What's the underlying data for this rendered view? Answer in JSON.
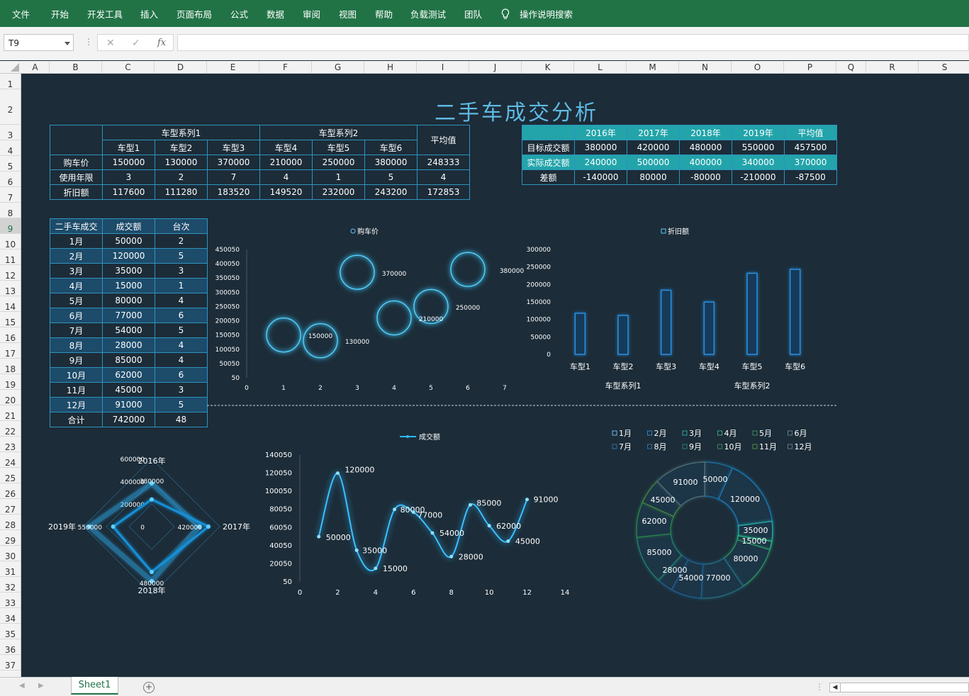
{
  "ribbon": {
    "tabs": [
      "文件",
      "开始",
      "开发工具",
      "插入",
      "页面布局",
      "公式",
      "数据",
      "审阅",
      "视图",
      "帮助",
      "负载测试",
      "团队"
    ],
    "search": "操作说明搜索"
  },
  "formula_bar": {
    "name_box": "T9",
    "cancel": "✕",
    "enter": "✓",
    "fx": "fx",
    "formula": ""
  },
  "columns": [
    "A",
    "B",
    "C",
    "D",
    "E",
    "F",
    "G",
    "H",
    "I",
    "J",
    "K",
    "L",
    "M",
    "N",
    "O",
    "P",
    "Q",
    "R",
    "S"
  ],
  "rows": [
    "1",
    "2",
    "3",
    "4",
    "5",
    "6",
    "7",
    "8",
    "9",
    "10",
    "11",
    "12",
    "13",
    "14",
    "15",
    "16",
    "17",
    "18",
    "19",
    "20",
    "21",
    "22",
    "23",
    "24",
    "25",
    "26",
    "27",
    "28",
    "29",
    "30",
    "31",
    "32",
    "33",
    "34",
    "35",
    "36",
    "37"
  ],
  "sheet_title": "二手车成交分析",
  "table1": {
    "group1": "车型系列1",
    "group2": "车型系列2",
    "avg": "平均值",
    "models": [
      "车型1",
      "车型2",
      "车型3",
      "车型4",
      "车型5",
      "车型6"
    ],
    "rows": [
      {
        "label": "购车价",
        "values": [
          "150000",
          "130000",
          "370000",
          "210000",
          "250000",
          "380000",
          "248333"
        ]
      },
      {
        "label": "使用年限",
        "values": [
          "3",
          "2",
          "7",
          "4",
          "1",
          "5",
          "4"
        ]
      },
      {
        "label": "折旧额",
        "values": [
          "117600",
          "111280",
          "183520",
          "149520",
          "232000",
          "243200",
          "172853"
        ]
      }
    ]
  },
  "table2": {
    "headers": [
      "",
      "2016年",
      "2017年",
      "2018年",
      "2019年",
      "平均值"
    ],
    "rows": [
      {
        "label": "目标成交额",
        "values": [
          "380000",
          "420000",
          "480000",
          "550000",
          "457500"
        ]
      },
      {
        "label": "实际成交额",
        "values": [
          "240000",
          "500000",
          "400000",
          "340000",
          "370000"
        ]
      },
      {
        "label": "差额",
        "values": [
          "-140000",
          "80000",
          "-80000",
          "-210000",
          "-87500"
        ]
      }
    ]
  },
  "table3": {
    "headers": [
      "二手车成交",
      "成交额",
      "台次"
    ],
    "rows": [
      [
        "1月",
        "50000",
        "2"
      ],
      [
        "2月",
        "120000",
        "5"
      ],
      [
        "3月",
        "35000",
        "3"
      ],
      [
        "4月",
        "15000",
        "1"
      ],
      [
        "5月",
        "80000",
        "4"
      ],
      [
        "6月",
        "77000",
        "6"
      ],
      [
        "7月",
        "54000",
        "5"
      ],
      [
        "8月",
        "28000",
        "4"
      ],
      [
        "9月",
        "85000",
        "4"
      ],
      [
        "10月",
        "62000",
        "6"
      ],
      [
        "11月",
        "45000",
        "3"
      ],
      [
        "12月",
        "91000",
        "5"
      ],
      [
        "合计",
        "742000",
        "48"
      ]
    ]
  },
  "chart_data": [
    {
      "type": "scatter",
      "chart": "bubble",
      "legend": "购车价",
      "x": [
        1,
        2,
        3,
        4,
        5,
        6
      ],
      "y": [
        150000,
        130000,
        370000,
        210000,
        250000,
        380000
      ],
      "labels": [
        "150000",
        "130000",
        "370000",
        "210000",
        "250000",
        "380000"
      ],
      "yticks": [
        "450050",
        "400050",
        "350050",
        "300050",
        "250050",
        "200050",
        "150050",
        "100050",
        "50050",
        "50"
      ],
      "xticks": [
        "0",
        "1",
        "2",
        "3",
        "4",
        "5",
        "6",
        "7"
      ],
      "ylim": [
        50,
        450050
      ],
      "xlim": [
        0,
        7
      ]
    },
    {
      "type": "bar",
      "legend": "折旧额",
      "categories": [
        "车型1",
        "车型2",
        "车型3",
        "车型4",
        "车型5",
        "车型6"
      ],
      "groups": [
        "车型系列1",
        "车型系列2"
      ],
      "values": [
        117600,
        111280,
        183520,
        149520,
        232000,
        243200
      ],
      "yticks": [
        "300000",
        "250000",
        "200000",
        "150000",
        "100000",
        "50000",
        "0"
      ],
      "ylim": [
        0,
        300000
      ]
    },
    {
      "type": "radar",
      "categories": [
        "2016年",
        "2017年",
        "2018年",
        "2019年"
      ],
      "series": [
        {
          "values": [
            380000,
            420000,
            480000,
            550000
          ]
        },
        {
          "values": [
            240000,
            500000,
            400000,
            340000
          ]
        }
      ],
      "rticks": [
        "600000",
        "400000",
        "200000",
        "0"
      ],
      "visible_labels": [
        "380000",
        "420000",
        "480000"
      ],
      "overlap_label": "550000",
      "rmax": 600000
    },
    {
      "type": "line",
      "smooth": true,
      "legend": "成交额",
      "x": [
        1,
        2,
        3,
        4,
        5,
        6,
        7,
        8,
        9,
        10,
        11,
        12
      ],
      "y": [
        50000,
        120000,
        35000,
        15000,
        80000,
        77000,
        54000,
        28000,
        85000,
        62000,
        45000,
        91000
      ],
      "labels": [
        "50000",
        "120000",
        "35000",
        "15000",
        "80000",
        "77000",
        "54000",
        "28000",
        "85000",
        "62000",
        "45000",
        "91000"
      ],
      "yticks": [
        "140050",
        "120050",
        "100050",
        "80050",
        "60050",
        "40050",
        "20050",
        "50"
      ],
      "xticks": [
        "0",
        "2",
        "4",
        "6",
        "8",
        "10",
        "12",
        "14"
      ],
      "ylim": [
        50,
        140050
      ],
      "xlim": [
        0,
        14
      ]
    },
    {
      "type": "pie",
      "chart": "doughnut",
      "categories": [
        "1月",
        "2月",
        "3月",
        "4月",
        "5月",
        "6月",
        "7月",
        "8月",
        "9月",
        "10月",
        "11月",
        "12月"
      ],
      "values": [
        50000,
        120000,
        35000,
        15000,
        80000,
        77000,
        54000,
        28000,
        85000,
        62000,
        45000,
        91000
      ],
      "labels": [
        "50000",
        "120000",
        "35000",
        "15000",
        "80000",
        "77000",
        "54000",
        "28000",
        "85000",
        "62000",
        "45000",
        "91000"
      ]
    }
  ],
  "sheet_tab": "Sheet1",
  "add_sheet": "+"
}
